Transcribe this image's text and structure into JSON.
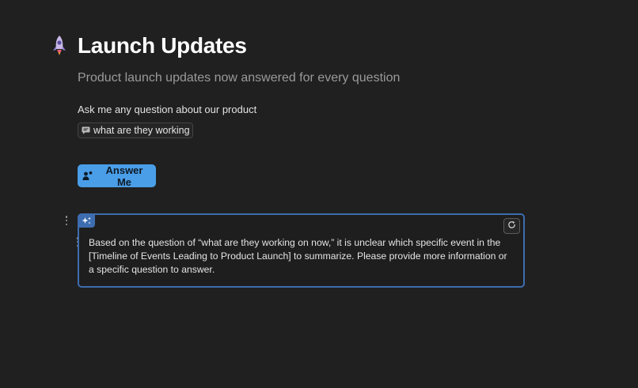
{
  "page": {
    "title": "Launch Updates",
    "subtitle": "Product launch updates now answered for every question",
    "icon": "rocket-icon"
  },
  "form": {
    "prompt_label": "Ask me any question about our product",
    "question_value": "what are they working on now",
    "question_icon": "chat-bubble-icon",
    "button_label": "Answer Me",
    "button_icon": "person-add-icon"
  },
  "answer": {
    "badge_icon": "sparkle-icon",
    "refresh_icon": "refresh-icon",
    "text": "Based on the question of “what are they working on now,” it is unclear which specific event in the [Timeline of Events Leading to Product Launch] to summarize. Please provide more information or a specific question to answer."
  },
  "colors": {
    "background": "#202020",
    "accent_button": "#4a9ee8",
    "answer_border": "#3d6db0",
    "subtitle": "#9a9a9a"
  }
}
